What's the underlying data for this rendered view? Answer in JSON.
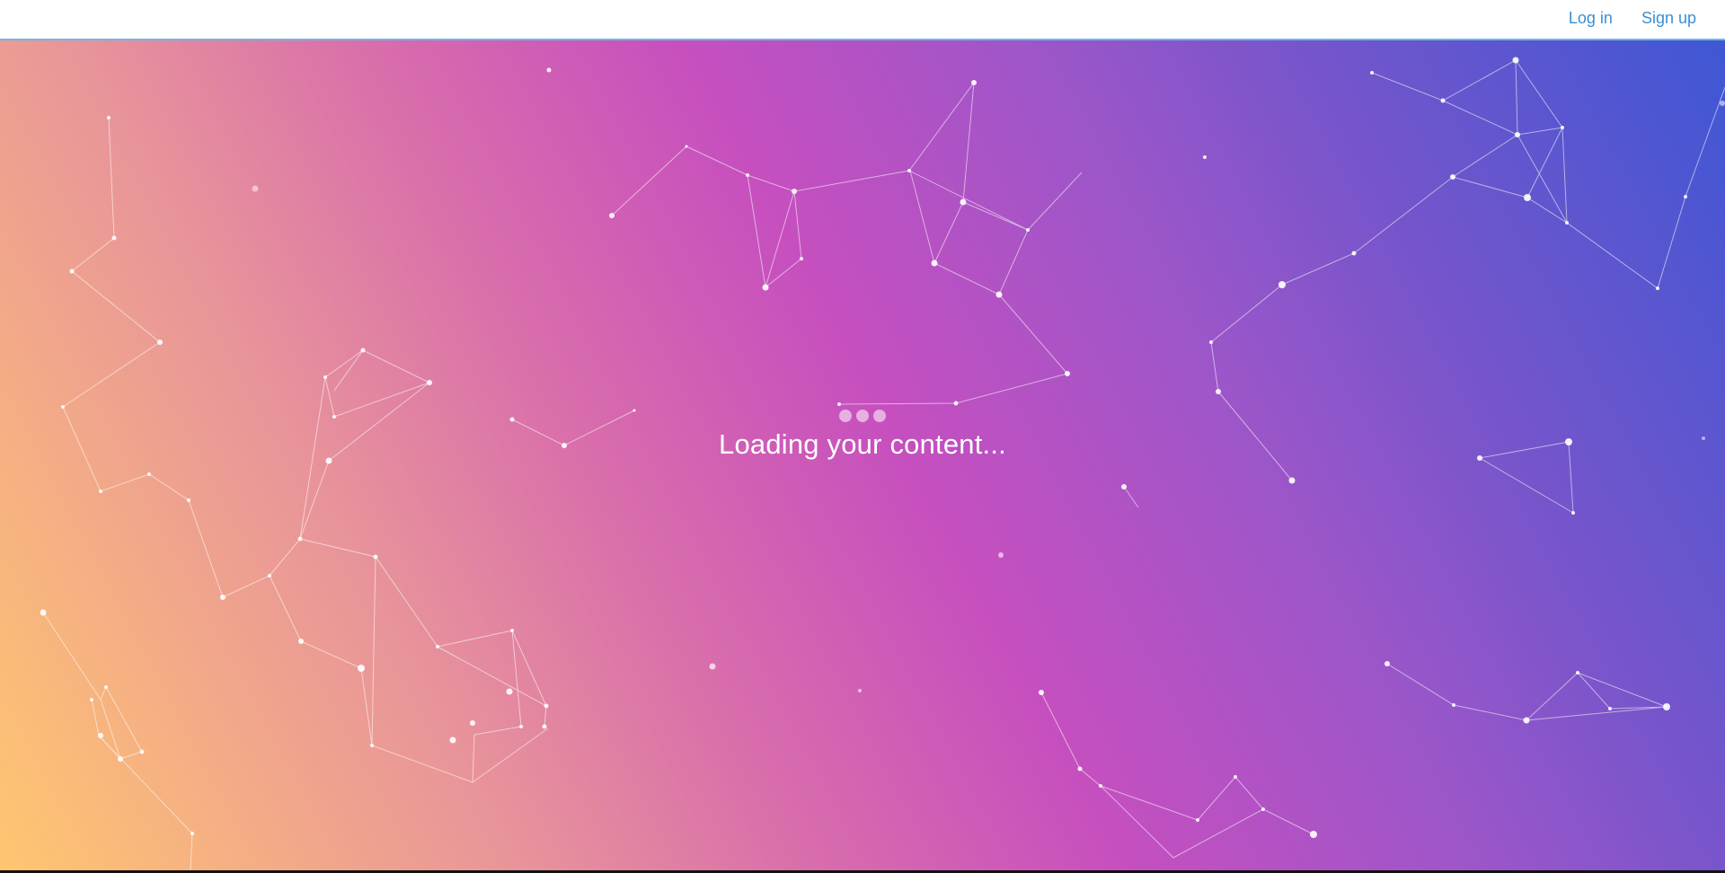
{
  "nav": {
    "login_label": "Log in",
    "signup_label": "Sign up"
  },
  "loader": {
    "text": "Loading your content..."
  },
  "colors": {
    "gradient": [
      "#ffc670",
      "#e8949a",
      "#c64fbf",
      "#7755cb",
      "#3f57d4"
    ],
    "link": "#3b8fd4",
    "header_border": "#6cb8e6"
  }
}
